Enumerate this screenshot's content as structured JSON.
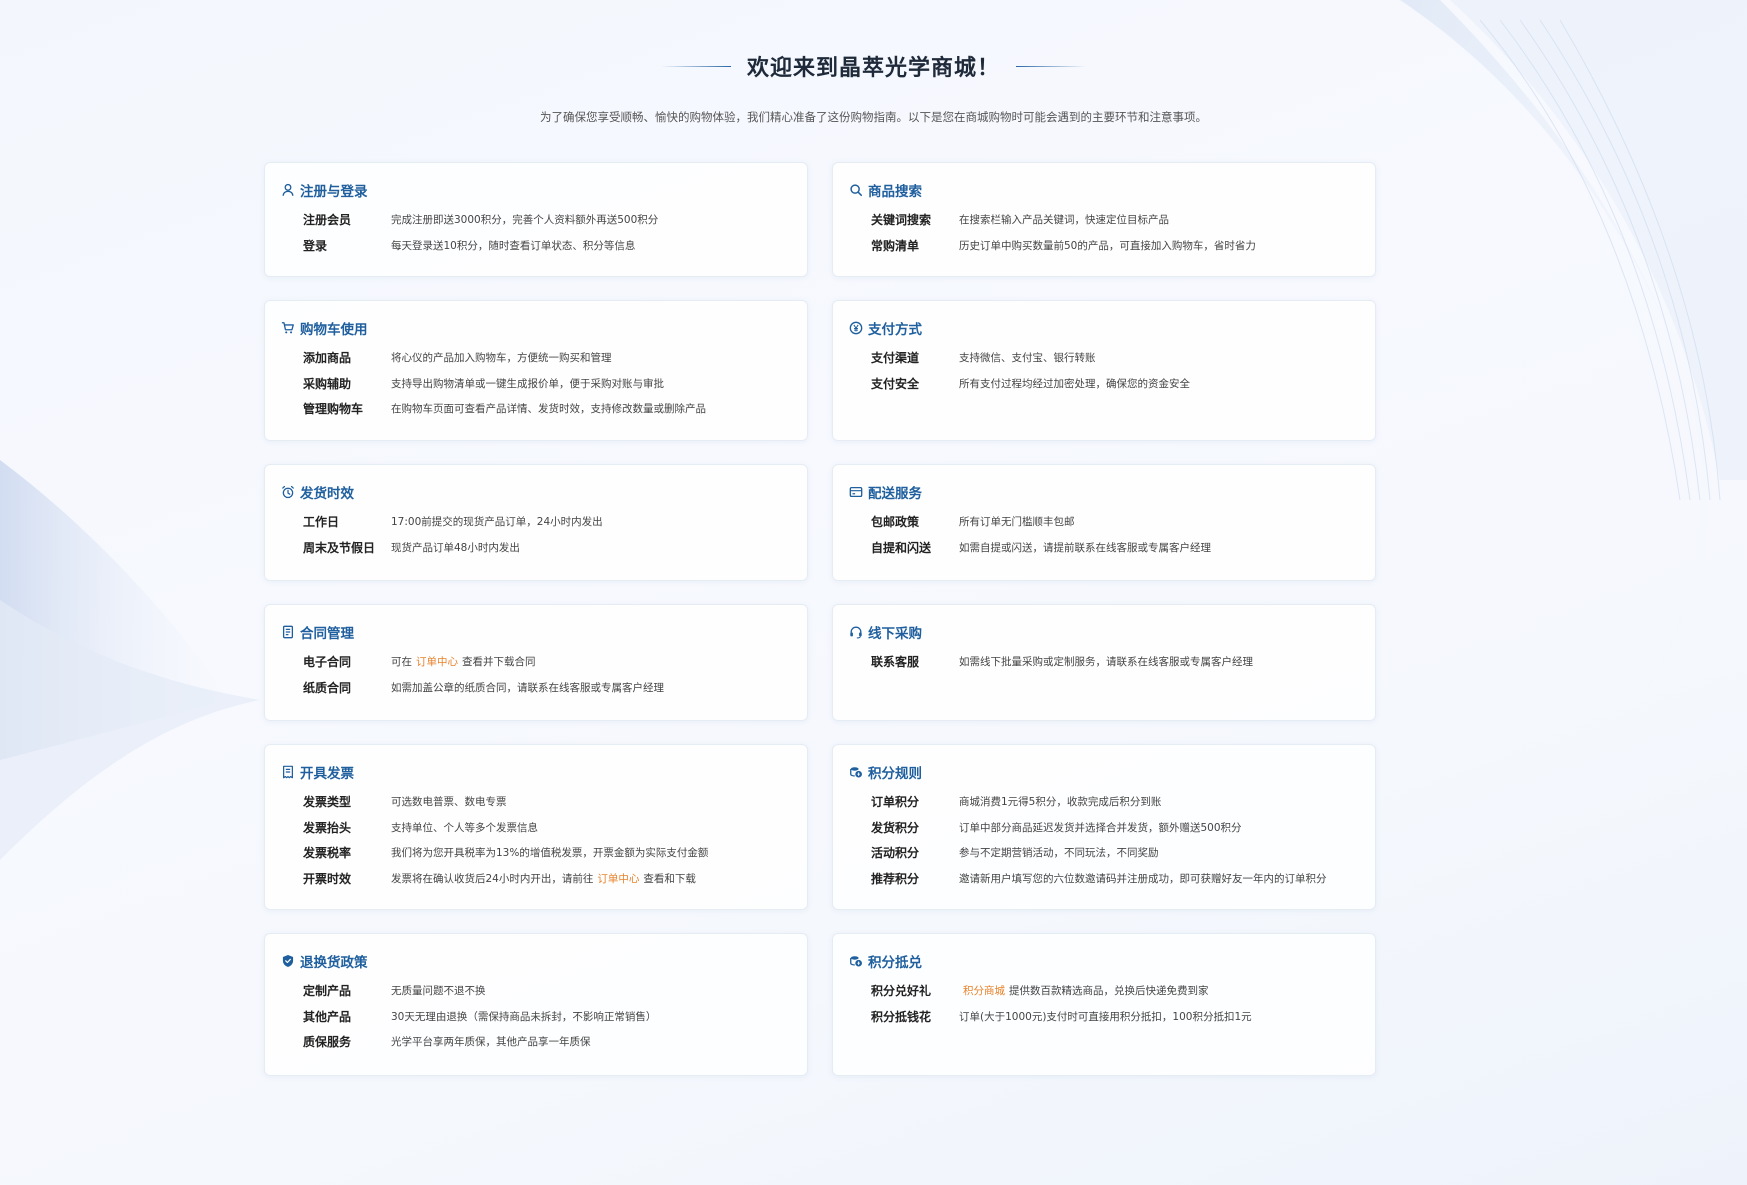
{
  "header": {
    "title": "欢迎来到晶萃光学商城！",
    "subtitle": "为了确保您享受顺畅、愉快的购物体验，我们精心准备了这份购物指南。以下是您在商城购物时可能会遇到的主要环节和注意事项。"
  },
  "colors": {
    "accent": "#1f5f9e",
    "link": "#e8822a",
    "label": "#222222"
  },
  "sections": {
    "register": {
      "title": "注册与登录",
      "icon": "user-icon",
      "items": [
        {
          "label": "注册会员",
          "text": "完成注册即送3000积分，完善个人资料额外再送500积分"
        },
        {
          "label": "登录",
          "text": "每天登录送10积分，随时查看订单状态、积分等信息"
        }
      ]
    },
    "search": {
      "title": "商品搜索",
      "icon": "search-icon",
      "items": [
        {
          "label": "关键词搜索",
          "text": "在搜索栏输入产品关键词，快速定位目标产品"
        },
        {
          "label": "常购清单",
          "text": "历史订单中购买数量前50的产品，可直接加入购物车，省时省力"
        }
      ]
    },
    "cart": {
      "title": "购物车使用",
      "icon": "cart-icon",
      "items": [
        {
          "label": "添加商品",
          "text": "将心仪的产品加入购物车，方便统一购买和管理"
        },
        {
          "label": "采购辅助",
          "text": "支持导出购物清单或一键生成报价单，便于采购对账与审批"
        },
        {
          "label": "管理购物车",
          "text": "在购物车页面可查看产品详情、发货时效，支持修改数量或删除产品"
        }
      ]
    },
    "payment": {
      "title": "支付方式",
      "icon": "yen-coin-icon",
      "items": [
        {
          "label": "支付渠道",
          "text": "支持微信、支付宝、银行转账"
        },
        {
          "label": "支付安全",
          "text": "所有支付过程均经过加密处理，确保您的资金安全"
        }
      ]
    },
    "shipping_time": {
      "title": "发货时效",
      "icon": "alarm-clock-icon",
      "items": [
        {
          "label": "工作日",
          "text": "17:00前提交的现货产品订单，24小时内发出"
        },
        {
          "label": "周末及节假日",
          "text": "现货产品订单48小时内发出"
        }
      ]
    },
    "delivery": {
      "title": "配送服务",
      "icon": "card-icon",
      "items": [
        {
          "label": "包邮政策",
          "text": "所有订单无门槛顺丰包邮"
        },
        {
          "label": "自提和闪送",
          "text": "如需自提或闪送，请提前联系在线客服或专属客户经理"
        }
      ]
    },
    "contract": {
      "title": "合同管理",
      "icon": "document-icon",
      "items": [
        {
          "label": "电子合同",
          "pre": "可在",
          "link": "订单中心",
          "post": "查看并下载合同"
        },
        {
          "label": "纸质合同",
          "text": "如需加盖公章的纸质合同，请联系在线客服或专属客户经理"
        }
      ]
    },
    "offline": {
      "title": "线下采购",
      "icon": "headset-icon",
      "items": [
        {
          "label": "联系客服",
          "text": "如需线下批量采购或定制服务，请联系在线客服或专属客户经理"
        }
      ]
    },
    "invoice": {
      "title": "开具发票",
      "icon": "receipt-icon",
      "items": [
        {
          "label": "发票类型",
          "text": "可选数电普票、数电专票"
        },
        {
          "label": "发票抬头",
          "text": "支持单位、个人等多个发票信息"
        },
        {
          "label": "发票税率",
          "text": "我们将为您开具税率为13%的增值税发票，开票金额为实际支付金额"
        },
        {
          "label": "开票时效",
          "pre": "发票将在确认收货后24小时内开出，请前往",
          "link": "订单中心",
          "post": "查看和下载"
        }
      ]
    },
    "points_rules": {
      "title": "积分规则",
      "icon": "coins-icon",
      "items": [
        {
          "label": "订单积分",
          "text": "商城消费1元得5积分，收款完成后积分到账"
        },
        {
          "label": "发货积分",
          "text": "订单中部分商品延迟发货并选择合并发货，额外赠送500积分"
        },
        {
          "label": "活动积分",
          "text": "参与不定期营销活动，不同玩法，不同奖励"
        },
        {
          "label": "推荐积分",
          "text": "邀请新用户填写您的六位数邀请码并注册成功，即可获赠好友一年内的订单积分"
        }
      ]
    },
    "returns": {
      "title": "退换货政策",
      "icon": "shield-icon",
      "items": [
        {
          "label": "定制产品",
          "text": "无质量问题不退不换"
        },
        {
          "label": "其他产品",
          "text": "30天无理由退换（需保持商品未拆封，不影响正常销售）"
        },
        {
          "label": "质保服务",
          "text": "光学平台享两年质保，其他产品享一年质保"
        }
      ]
    },
    "points_redeem": {
      "title": "积分抵兑",
      "icon": "coins-icon",
      "items": [
        {
          "label": "积分兑好礼",
          "pre": "",
          "link": "积分商城",
          "post": "提供数百款精选商品，兑换后快递免费到家"
        },
        {
          "label": "积分抵钱花",
          "text": "订单(大于1000元)支付时可直接用积分抵扣，100积分抵扣1元"
        }
      ]
    }
  }
}
